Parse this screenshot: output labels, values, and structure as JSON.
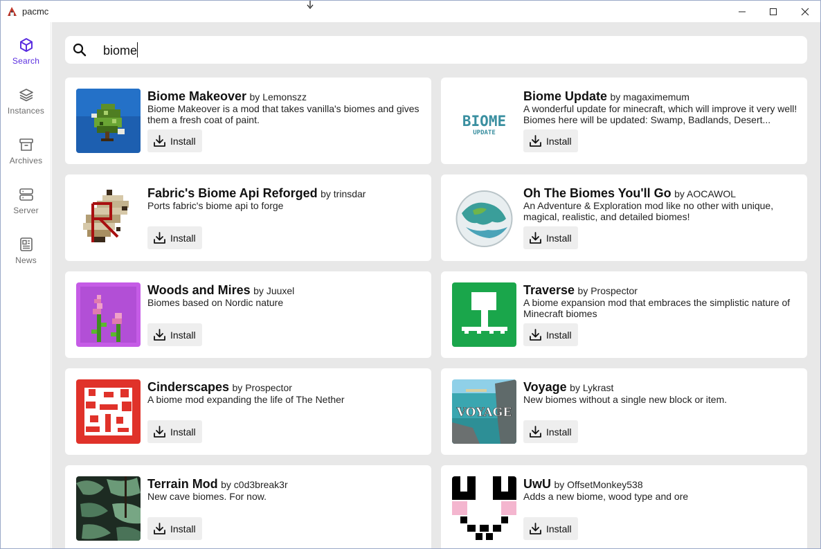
{
  "window": {
    "title": "pacmc"
  },
  "sidebar": {
    "items": [
      {
        "label": "Search",
        "icon": "cube-icon",
        "active": true
      },
      {
        "label": "Instances",
        "icon": "layers-icon",
        "active": false
      },
      {
        "label": "Archives",
        "icon": "archive-icon",
        "active": false
      },
      {
        "label": "Server",
        "icon": "server-icon",
        "active": false
      },
      {
        "label": "News",
        "icon": "newspaper-icon",
        "active": false
      }
    ]
  },
  "search": {
    "value": "biome"
  },
  "install_label": "Install",
  "results": [
    {
      "name": "Biome Makeover",
      "by": "by Lemonszz",
      "description": "Biome Makeover is a mod that takes vanilla's biomes and gives them a fresh coat of paint."
    },
    {
      "name": "Biome Update",
      "by": "by magaximemum",
      "description": "A wonderful update for minecraft, which will improve it very well! Biomes here will be updated: Swamp, Badlands, Desert..."
    },
    {
      "name": "Fabric's Biome Api Reforged",
      "by": "by trinsdar",
      "description": "Ports fabric's biome api to forge"
    },
    {
      "name": "Oh The Biomes You'll Go",
      "by": "by AOCAWOL",
      "description": "An Adventure & Exploration mod like no other with unique, magical, realistic, and detailed biomes!"
    },
    {
      "name": "Woods and Mires",
      "by": "by Juuxel",
      "description": "Biomes based on Nordic nature"
    },
    {
      "name": "Traverse",
      "by": "by Prospector",
      "description": "A biome expansion mod that embraces the simplistic nature of Minecraft biomes"
    },
    {
      "name": "Cinderscapes",
      "by": "by Prospector",
      "description": "A biome mod expanding the life of The Nether"
    },
    {
      "name": "Voyage",
      "by": "by Lykrast",
      "description": "New biomes without a single new block or item."
    },
    {
      "name": "Terrain Mod",
      "by": "by c0d3break3r",
      "description": "New cave biomes. For now."
    },
    {
      "name": "UwU",
      "by": "by OffsetMonkey538",
      "description": "Adds a new biome, wood type and ore"
    }
  ],
  "thumb_text": {
    "biome_update": "BIOME",
    "biome_update_sub": "UPDATE",
    "voyage": "VOYAGE"
  },
  "colors": {
    "accent": "#5b2ee0",
    "background": "#e8e8e8",
    "traverse_green": "#1aa64b",
    "cinderscapes_red": "#e0322a"
  }
}
